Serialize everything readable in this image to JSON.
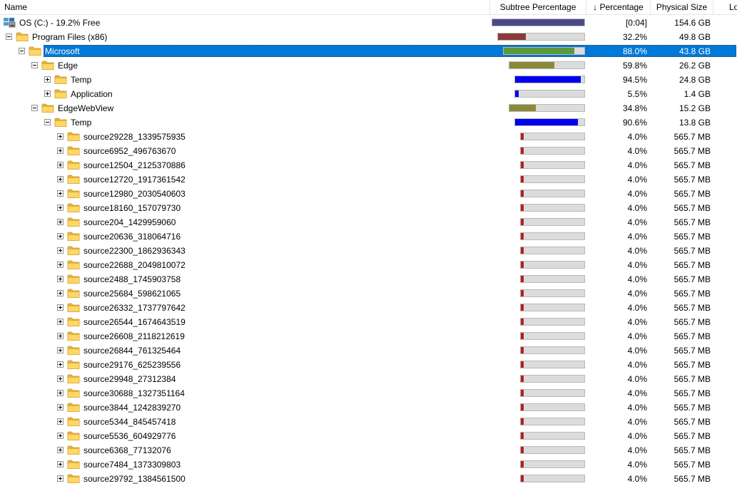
{
  "columns": {
    "name": "Name",
    "subtree": "Subtree Percentage",
    "percentage": "↓ Percentage",
    "physical_size": "Physical Size",
    "extra": "Lo"
  },
  "colors": {
    "selected": "#0078d7",
    "root_bar": "#4a4a8a",
    "l1_bar": "#8b3a3a",
    "l2_bar": "#5a9a3a",
    "l3_bar": "#8a8a3a",
    "l4_bar": "#0000ee",
    "l5_bar": "#b02020"
  },
  "rows": [
    {
      "label": "OS (C:) - 19.2% Free",
      "level": 0,
      "icon": "drive-icon",
      "pct_text": "[0:04]",
      "size": "154.6 GB",
      "bar": 1.0,
      "bar_color": "#4a4a8a",
      "selected": false
    },
    {
      "label": "Program Files (x86)",
      "level": 1,
      "expander": "minus",
      "icon": "folder-icon",
      "pct_text": "32.2%",
      "size": "49.8 GB",
      "bar": 0.322,
      "bar_color": "#8b3a3a",
      "selected": false
    },
    {
      "label": "Microsoft",
      "level": 2,
      "expander": "minus",
      "icon": "folder-icon",
      "pct_text": "88.0%",
      "size": "43.8 GB",
      "bar": 0.88,
      "bar_color": "#5a9a3a",
      "selected": true
    },
    {
      "label": "Edge",
      "level": 3,
      "expander": "minus",
      "icon": "folder-icon",
      "pct_text": "59.8%",
      "size": "26.2 GB",
      "bar": 0.598,
      "bar_color": "#8a8a3a",
      "selected": false
    },
    {
      "label": "Temp",
      "level": 4,
      "expander": "plus",
      "icon": "folder-icon",
      "pct_text": "94.5%",
      "size": "24.8 GB",
      "bar": 0.945,
      "bar_color": "#0000ee",
      "selected": false
    },
    {
      "label": "Application",
      "level": 4,
      "expander": "plus",
      "icon": "folder-icon",
      "pct_text": "5.5%",
      "size": "1.4 GB",
      "bar": 0.055,
      "bar_color": "#0000ee",
      "selected": false
    },
    {
      "label": "EdgeWebView",
      "level": 3,
      "expander": "minus",
      "icon": "folder-icon",
      "pct_text": "34.8%",
      "size": "15.2 GB",
      "bar": 0.348,
      "bar_color": "#8a8a3a",
      "selected": false
    },
    {
      "label": "Temp",
      "level": 4,
      "expander": "minus",
      "icon": "folder-icon",
      "pct_text": "90.6%",
      "size": "13.8 GB",
      "bar": 0.906,
      "bar_color": "#0000ee",
      "selected": false
    },
    {
      "label": "source29228_1339575935",
      "level": 5,
      "expander": "plus",
      "icon": "folder-icon",
      "pct_text": "4.0%",
      "size": "565.7 MB",
      "bar": 0.04,
      "bar_color": "#b02020",
      "selected": false
    },
    {
      "label": "source6952_496763670",
      "level": 5,
      "expander": "plus",
      "icon": "folder-icon",
      "pct_text": "4.0%",
      "size": "565.7 MB",
      "bar": 0.04,
      "bar_color": "#b02020",
      "selected": false
    },
    {
      "label": "source12504_2125370886",
      "level": 5,
      "expander": "plus",
      "icon": "folder-icon",
      "pct_text": "4.0%",
      "size": "565.7 MB",
      "bar": 0.04,
      "bar_color": "#b02020",
      "selected": false
    },
    {
      "label": "source12720_1917361542",
      "level": 5,
      "expander": "plus",
      "icon": "folder-icon",
      "pct_text": "4.0%",
      "size": "565.7 MB",
      "bar": 0.04,
      "bar_color": "#b02020",
      "selected": false
    },
    {
      "label": "source12980_2030540603",
      "level": 5,
      "expander": "plus",
      "icon": "folder-icon",
      "pct_text": "4.0%",
      "size": "565.7 MB",
      "bar": 0.04,
      "bar_color": "#b02020",
      "selected": false
    },
    {
      "label": "source18160_157079730",
      "level": 5,
      "expander": "plus",
      "icon": "folder-icon",
      "pct_text": "4.0%",
      "size": "565.7 MB",
      "bar": 0.04,
      "bar_color": "#b02020",
      "selected": false
    },
    {
      "label": "source204_1429959060",
      "level": 5,
      "expander": "plus",
      "icon": "folder-icon",
      "pct_text": "4.0%",
      "size": "565.7 MB",
      "bar": 0.04,
      "bar_color": "#b02020",
      "selected": false
    },
    {
      "label": "source20636_318064716",
      "level": 5,
      "expander": "plus",
      "icon": "folder-icon",
      "pct_text": "4.0%",
      "size": "565.7 MB",
      "bar": 0.04,
      "bar_color": "#b02020",
      "selected": false
    },
    {
      "label": "source22300_1862936343",
      "level": 5,
      "expander": "plus",
      "icon": "folder-icon",
      "pct_text": "4.0%",
      "size": "565.7 MB",
      "bar": 0.04,
      "bar_color": "#b02020",
      "selected": false
    },
    {
      "label": "source22688_2049810072",
      "level": 5,
      "expander": "plus",
      "icon": "folder-icon",
      "pct_text": "4.0%",
      "size": "565.7 MB",
      "bar": 0.04,
      "bar_color": "#b02020",
      "selected": false
    },
    {
      "label": "source2488_1745903758",
      "level": 5,
      "expander": "plus",
      "icon": "folder-icon",
      "pct_text": "4.0%",
      "size": "565.7 MB",
      "bar": 0.04,
      "bar_color": "#b02020",
      "selected": false
    },
    {
      "label": "source25684_598621065",
      "level": 5,
      "expander": "plus",
      "icon": "folder-icon",
      "pct_text": "4.0%",
      "size": "565.7 MB",
      "bar": 0.04,
      "bar_color": "#b02020",
      "selected": false
    },
    {
      "label": "source26332_1737797642",
      "level": 5,
      "expander": "plus",
      "icon": "folder-icon",
      "pct_text": "4.0%",
      "size": "565.7 MB",
      "bar": 0.04,
      "bar_color": "#b02020",
      "selected": false
    },
    {
      "label": "source26544_1674643519",
      "level": 5,
      "expander": "plus",
      "icon": "folder-icon",
      "pct_text": "4.0%",
      "size": "565.7 MB",
      "bar": 0.04,
      "bar_color": "#b02020",
      "selected": false
    },
    {
      "label": "source26608_2118212619",
      "level": 5,
      "expander": "plus",
      "icon": "folder-icon",
      "pct_text": "4.0%",
      "size": "565.7 MB",
      "bar": 0.04,
      "bar_color": "#b02020",
      "selected": false
    },
    {
      "label": "source26844_761325464",
      "level": 5,
      "expander": "plus",
      "icon": "folder-icon",
      "pct_text": "4.0%",
      "size": "565.7 MB",
      "bar": 0.04,
      "bar_color": "#b02020",
      "selected": false
    },
    {
      "label": "source29176_625239556",
      "level": 5,
      "expander": "plus",
      "icon": "folder-icon",
      "pct_text": "4.0%",
      "size": "565.7 MB",
      "bar": 0.04,
      "bar_color": "#b02020",
      "selected": false
    },
    {
      "label": "source29948_27312384",
      "level": 5,
      "expander": "plus",
      "icon": "folder-icon",
      "pct_text": "4.0%",
      "size": "565.7 MB",
      "bar": 0.04,
      "bar_color": "#b02020",
      "selected": false
    },
    {
      "label": "source30688_1327351164",
      "level": 5,
      "expander": "plus",
      "icon": "folder-icon",
      "pct_text": "4.0%",
      "size": "565.7 MB",
      "bar": 0.04,
      "bar_color": "#b02020",
      "selected": false
    },
    {
      "label": "source3844_1242839270",
      "level": 5,
      "expander": "plus",
      "icon": "folder-icon",
      "pct_text": "4.0%",
      "size": "565.7 MB",
      "bar": 0.04,
      "bar_color": "#b02020",
      "selected": false
    },
    {
      "label": "source5344_845457418",
      "level": 5,
      "expander": "plus",
      "icon": "folder-icon",
      "pct_text": "4.0%",
      "size": "565.7 MB",
      "bar": 0.04,
      "bar_color": "#b02020",
      "selected": false
    },
    {
      "label": "source5536_604929776",
      "level": 5,
      "expander": "plus",
      "icon": "folder-icon",
      "pct_text": "4.0%",
      "size": "565.7 MB",
      "bar": 0.04,
      "bar_color": "#b02020",
      "selected": false
    },
    {
      "label": "source6368_77132076",
      "level": 5,
      "expander": "plus",
      "icon": "folder-icon",
      "pct_text": "4.0%",
      "size": "565.7 MB",
      "bar": 0.04,
      "bar_color": "#b02020",
      "selected": false
    },
    {
      "label": "source7484_1373309803",
      "level": 5,
      "expander": "plus",
      "icon": "folder-icon",
      "pct_text": "4.0%",
      "size": "565.7 MB",
      "bar": 0.04,
      "bar_color": "#b02020",
      "selected": false
    },
    {
      "label": "source29792_1384561500",
      "level": 5,
      "expander": "plus",
      "icon": "folder-icon",
      "pct_text": "4.0%",
      "size": "565.7 MB",
      "bar": 0.04,
      "bar_color": "#b02020",
      "selected": false
    }
  ]
}
